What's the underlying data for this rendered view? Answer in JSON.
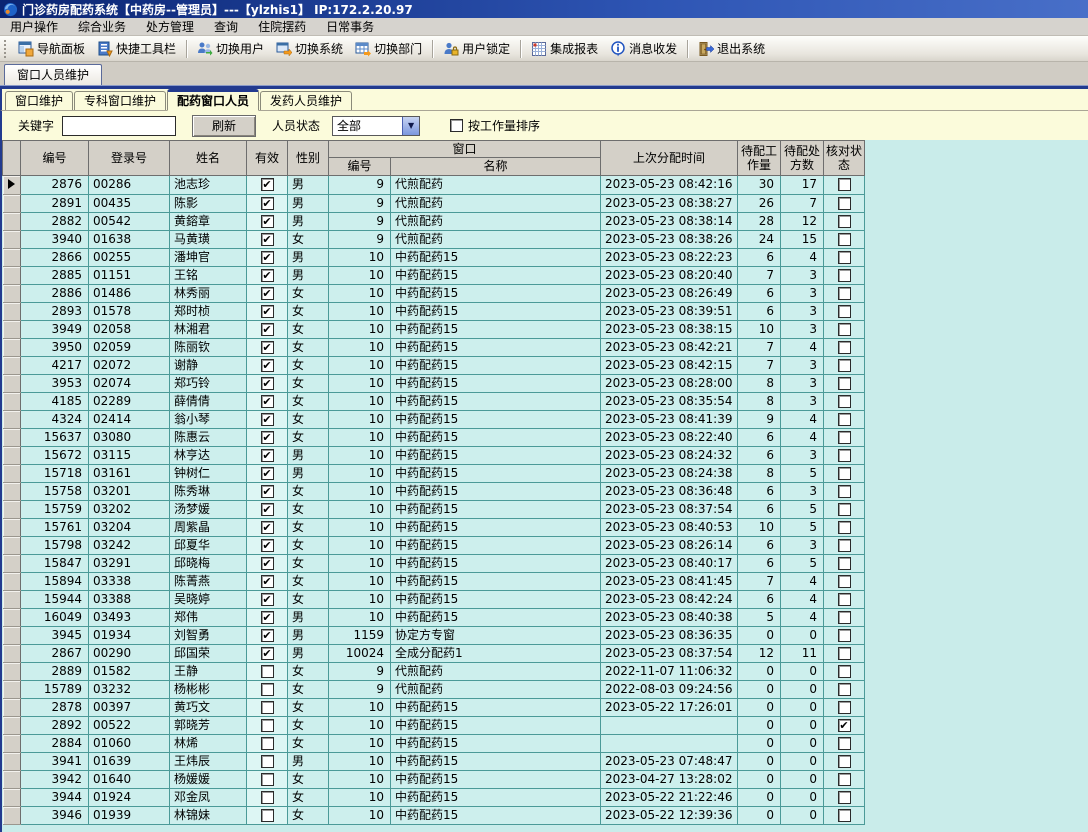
{
  "window": {
    "title": "门诊药房配药系统【中药房--管理员】---【ylzhis1】  IP:172.2.20.97"
  },
  "menu": {
    "items": [
      "用户操作",
      "综合业务",
      "处方管理",
      "查询",
      "住院摆药",
      "日常事务"
    ]
  },
  "toolbar": {
    "items": [
      {
        "icon": "nav-panel-icon",
        "label": "导航面板"
      },
      {
        "icon": "quick-toolbar-icon",
        "label": "快捷工具栏"
      },
      {
        "icon": "switch-user-icon",
        "label": "切换用户"
      },
      {
        "icon": "switch-system-icon",
        "label": "切换系统"
      },
      {
        "icon": "switch-dept-icon",
        "label": "切换部门"
      },
      {
        "icon": "user-lock-icon",
        "label": "用户锁定"
      },
      {
        "icon": "report-icon",
        "label": "集成报表"
      },
      {
        "icon": "message-icon",
        "label": "消息收发"
      },
      {
        "icon": "exit-icon",
        "label": "退出系统"
      }
    ]
  },
  "main_tab": {
    "label": "窗口人员维护"
  },
  "sub_tabs": [
    {
      "label": "窗口维护",
      "active": false
    },
    {
      "label": "专科窗口维护",
      "active": false
    },
    {
      "label": "配药窗口人员",
      "active": true
    },
    {
      "label": "发药人员维护",
      "active": false
    }
  ],
  "filter": {
    "keyword_label": "关键字",
    "keyword_value": "",
    "refresh_label": "刷新",
    "status_label": "人员状态",
    "status_value": "全部",
    "sort_label": "按工作量排序",
    "sort_checked": false
  },
  "table": {
    "headers": {
      "id": "编号",
      "login": "登录号",
      "name": "姓名",
      "valid": "有效",
      "gender": "性别",
      "window_group": "窗口",
      "win_id": "编号",
      "win_name": "名称",
      "last_time": "上次分配时间",
      "pending_work": "待配工作量",
      "pending_rx": "待配处方数",
      "check_status": "核对状态"
    },
    "current_row_index": 0,
    "rows": [
      {
        "id": "2876",
        "login": "00286",
        "name": "池志珍",
        "valid": true,
        "gender": "男",
        "win_id": "9",
        "win_name": "代煎配药",
        "last_time": "2023-05-23 08:42:16",
        "work": "30",
        "rx": "17",
        "checked": false
      },
      {
        "id": "2891",
        "login": "00435",
        "name": "陈影",
        "valid": true,
        "gender": "男",
        "win_id": "9",
        "win_name": "代煎配药",
        "last_time": "2023-05-23 08:38:27",
        "work": "26",
        "rx": "7",
        "checked": false
      },
      {
        "id": "2882",
        "login": "00542",
        "name": "黄鎔章",
        "valid": true,
        "gender": "男",
        "win_id": "9",
        "win_name": "代煎配药",
        "last_time": "2023-05-23 08:38:14",
        "work": "28",
        "rx": "12",
        "checked": false
      },
      {
        "id": "3940",
        "login": "01638",
        "name": "马黄璜",
        "valid": true,
        "gender": "女",
        "win_id": "9",
        "win_name": "代煎配药",
        "last_time": "2023-05-23 08:38:26",
        "work": "24",
        "rx": "15",
        "checked": false
      },
      {
        "id": "2866",
        "login": "00255",
        "name": "潘坤官",
        "valid": true,
        "gender": "男",
        "win_id": "10",
        "win_name": "中药配药15",
        "last_time": "2023-05-23 08:22:23",
        "work": "6",
        "rx": "4",
        "checked": false
      },
      {
        "id": "2885",
        "login": "01151",
        "name": "王铭",
        "valid": true,
        "gender": "男",
        "win_id": "10",
        "win_name": "中药配药15",
        "last_time": "2023-05-23 08:20:40",
        "work": "7",
        "rx": "3",
        "checked": false
      },
      {
        "id": "2886",
        "login": "01486",
        "name": "林秀丽",
        "valid": true,
        "gender": "女",
        "win_id": "10",
        "win_name": "中药配药15",
        "last_time": "2023-05-23 08:26:49",
        "work": "6",
        "rx": "3",
        "checked": false
      },
      {
        "id": "2893",
        "login": "01578",
        "name": "郑时桢",
        "valid": true,
        "gender": "女",
        "win_id": "10",
        "win_name": "中药配药15",
        "last_time": "2023-05-23 08:39:51",
        "work": "6",
        "rx": "3",
        "checked": false
      },
      {
        "id": "3949",
        "login": "02058",
        "name": "林湘君",
        "valid": true,
        "gender": "女",
        "win_id": "10",
        "win_name": "中药配药15",
        "last_time": "2023-05-23 08:38:15",
        "work": "10",
        "rx": "3",
        "checked": false
      },
      {
        "id": "3950",
        "login": "02059",
        "name": "陈丽钦",
        "valid": true,
        "gender": "女",
        "win_id": "10",
        "win_name": "中药配药15",
        "last_time": "2023-05-23 08:42:21",
        "work": "7",
        "rx": "4",
        "checked": false
      },
      {
        "id": "4217",
        "login": "02072",
        "name": "谢静",
        "valid": true,
        "gender": "女",
        "win_id": "10",
        "win_name": "中药配药15",
        "last_time": "2023-05-23 08:42:15",
        "work": "7",
        "rx": "3",
        "checked": false
      },
      {
        "id": "3953",
        "login": "02074",
        "name": "郑巧铃",
        "valid": true,
        "gender": "女",
        "win_id": "10",
        "win_name": "中药配药15",
        "last_time": "2023-05-23 08:28:00",
        "work": "8",
        "rx": "3",
        "checked": false
      },
      {
        "id": "4185",
        "login": "02289",
        "name": "薛倩倩",
        "valid": true,
        "gender": "女",
        "win_id": "10",
        "win_name": "中药配药15",
        "last_time": "2023-05-23 08:35:54",
        "work": "8",
        "rx": "3",
        "checked": false
      },
      {
        "id": "4324",
        "login": "02414",
        "name": "翁小琴",
        "valid": true,
        "gender": "女",
        "win_id": "10",
        "win_name": "中药配药15",
        "last_time": "2023-05-23 08:41:39",
        "work": "9",
        "rx": "4",
        "checked": false
      },
      {
        "id": "15637",
        "login": "03080",
        "name": "陈惠云",
        "valid": true,
        "gender": "女",
        "win_id": "10",
        "win_name": "中药配药15",
        "last_time": "2023-05-23 08:22:40",
        "work": "6",
        "rx": "4",
        "checked": false
      },
      {
        "id": "15672",
        "login": "03115",
        "name": "林亨达",
        "valid": true,
        "gender": "男",
        "win_id": "10",
        "win_name": "中药配药15",
        "last_time": "2023-05-23 08:24:32",
        "work": "6",
        "rx": "3",
        "checked": false
      },
      {
        "id": "15718",
        "login": "03161",
        "name": "钟树仁",
        "valid": true,
        "gender": "男",
        "win_id": "10",
        "win_name": "中药配药15",
        "last_time": "2023-05-23 08:24:38",
        "work": "8",
        "rx": "5",
        "checked": false
      },
      {
        "id": "15758",
        "login": "03201",
        "name": "陈秀琳",
        "valid": true,
        "gender": "女",
        "win_id": "10",
        "win_name": "中药配药15",
        "last_time": "2023-05-23 08:36:48",
        "work": "6",
        "rx": "3",
        "checked": false
      },
      {
        "id": "15759",
        "login": "03202",
        "name": "汤梦媛",
        "valid": true,
        "gender": "女",
        "win_id": "10",
        "win_name": "中药配药15",
        "last_time": "2023-05-23 08:37:54",
        "work": "6",
        "rx": "5",
        "checked": false
      },
      {
        "id": "15761",
        "login": "03204",
        "name": "周紫晶",
        "valid": true,
        "gender": "女",
        "win_id": "10",
        "win_name": "中药配药15",
        "last_time": "2023-05-23 08:40:53",
        "work": "10",
        "rx": "5",
        "checked": false
      },
      {
        "id": "15798",
        "login": "03242",
        "name": "邱夏华",
        "valid": true,
        "gender": "女",
        "win_id": "10",
        "win_name": "中药配药15",
        "last_time": "2023-05-23 08:26:14",
        "work": "6",
        "rx": "3",
        "checked": false
      },
      {
        "id": "15847",
        "login": "03291",
        "name": "邱晓梅",
        "valid": true,
        "gender": "女",
        "win_id": "10",
        "win_name": "中药配药15",
        "last_time": "2023-05-23 08:40:17",
        "work": "6",
        "rx": "5",
        "checked": false
      },
      {
        "id": "15894",
        "login": "03338",
        "name": "陈菁燕",
        "valid": true,
        "gender": "女",
        "win_id": "10",
        "win_name": "中药配药15",
        "last_time": "2023-05-23 08:41:45",
        "work": "7",
        "rx": "4",
        "checked": false
      },
      {
        "id": "15944",
        "login": "03388",
        "name": "吴晓婷",
        "valid": true,
        "gender": "女",
        "win_id": "10",
        "win_name": "中药配药15",
        "last_time": "2023-05-23 08:42:24",
        "work": "6",
        "rx": "4",
        "checked": false
      },
      {
        "id": "16049",
        "login": "03493",
        "name": "郑伟",
        "valid": true,
        "gender": "男",
        "win_id": "10",
        "win_name": "中药配药15",
        "last_time": "2023-05-23 08:40:38",
        "work": "5",
        "rx": "4",
        "checked": false
      },
      {
        "id": "3945",
        "login": "01934",
        "name": "刘智勇",
        "valid": true,
        "gender": "男",
        "win_id": "1159",
        "win_name": "协定方专窗",
        "last_time": "2023-05-23 08:36:35",
        "work": "0",
        "rx": "0",
        "checked": false
      },
      {
        "id": "2867",
        "login": "00290",
        "name": "邱国荣",
        "valid": true,
        "gender": "男",
        "win_id": "10024",
        "win_name": "全成分配药1",
        "last_time": "2023-05-23 08:37:54",
        "work": "12",
        "rx": "11",
        "checked": false
      },
      {
        "id": "2889",
        "login": "01582",
        "name": "王静",
        "valid": false,
        "gender": "女",
        "win_id": "9",
        "win_name": "代煎配药",
        "last_time": "2022-11-07 11:06:32",
        "work": "0",
        "rx": "0",
        "checked": false
      },
      {
        "id": "15789",
        "login": "03232",
        "name": "杨彬彬",
        "valid": false,
        "gender": "女",
        "win_id": "9",
        "win_name": "代煎配药",
        "last_time": "2022-08-03 09:24:56",
        "work": "0",
        "rx": "0",
        "checked": false
      },
      {
        "id": "2878",
        "login": "00397",
        "name": "黄巧文",
        "valid": false,
        "gender": "女",
        "win_id": "10",
        "win_name": "中药配药15",
        "last_time": "2023-05-22 17:26:01",
        "work": "0",
        "rx": "0",
        "checked": false
      },
      {
        "id": "2892",
        "login": "00522",
        "name": "郭晓芳",
        "valid": false,
        "gender": "女",
        "win_id": "10",
        "win_name": "中药配药15",
        "last_time": "",
        "work": "0",
        "rx": "0",
        "checked": true
      },
      {
        "id": "2884",
        "login": "01060",
        "name": "林烯",
        "valid": false,
        "gender": "女",
        "win_id": "10",
        "win_name": "中药配药15",
        "last_time": "",
        "work": "0",
        "rx": "0",
        "checked": false
      },
      {
        "id": "3941",
        "login": "01639",
        "name": "王炜辰",
        "valid": false,
        "gender": "男",
        "win_id": "10",
        "win_name": "中药配药15",
        "last_time": "2023-05-23 07:48:47",
        "work": "0",
        "rx": "0",
        "checked": false
      },
      {
        "id": "3942",
        "login": "01640",
        "name": "杨媛媛",
        "valid": false,
        "gender": "女",
        "win_id": "10",
        "win_name": "中药配药15",
        "last_time": "2023-04-27 13:28:02",
        "work": "0",
        "rx": "0",
        "checked": false
      },
      {
        "id": "3944",
        "login": "01924",
        "name": "邓金凤",
        "valid": false,
        "gender": "女",
        "win_id": "10",
        "win_name": "中药配药15",
        "last_time": "2023-05-22 21:22:46",
        "work": "0",
        "rx": "0",
        "checked": false
      },
      {
        "id": "3946",
        "login": "01939",
        "name": "林锦妹",
        "valid": false,
        "gender": "女",
        "win_id": "10",
        "win_name": "中药配药15",
        "last_time": "2023-05-22 12:39:36",
        "work": "0",
        "rx": "0",
        "checked": false
      }
    ]
  }
}
